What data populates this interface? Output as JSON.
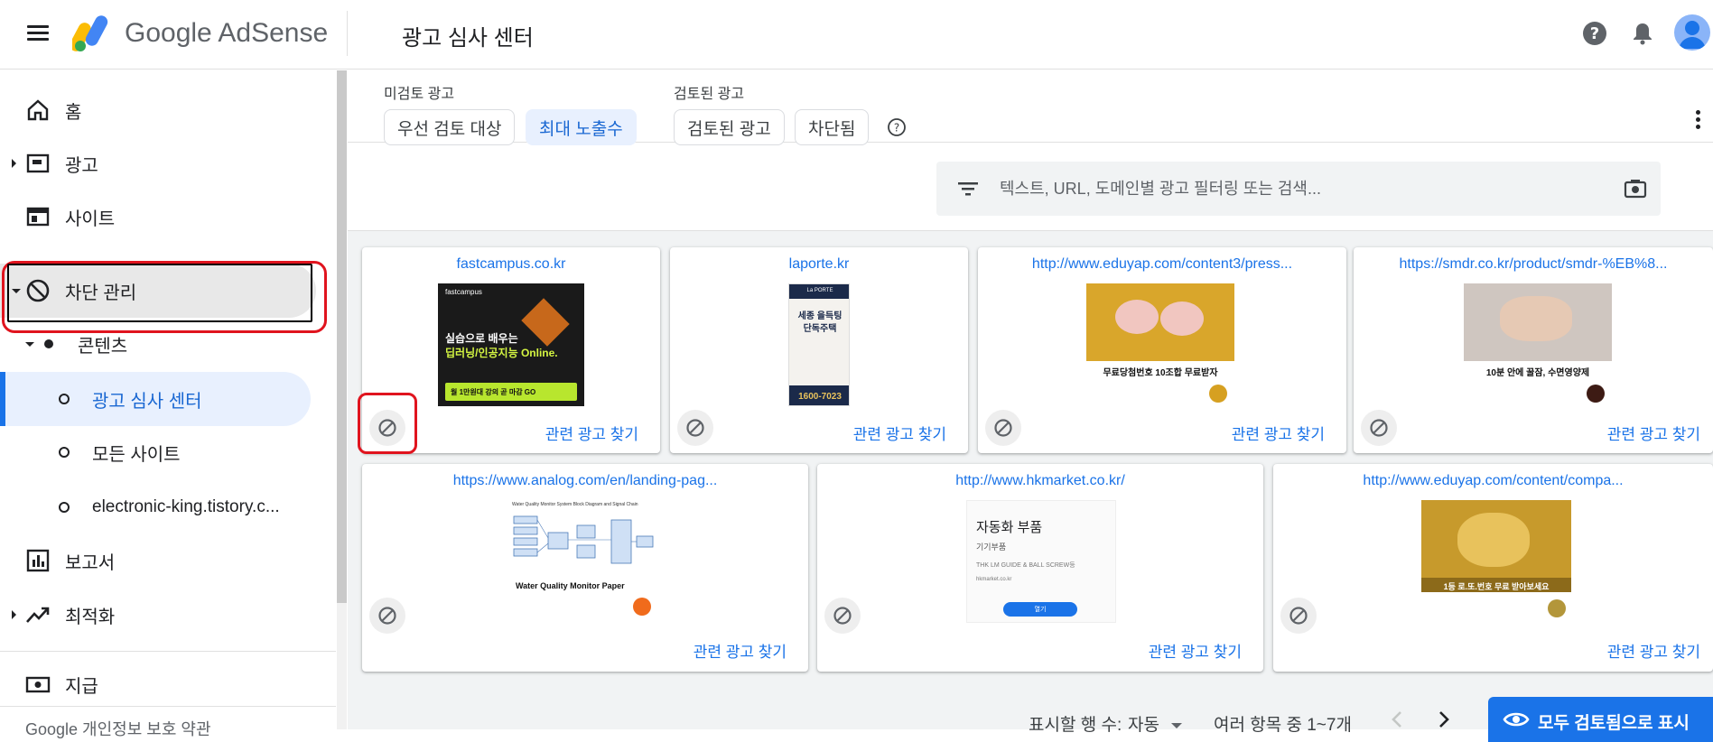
{
  "header": {
    "brand": "Google AdSense",
    "title": "광고 심사 센터"
  },
  "sidebar": {
    "items": [
      {
        "label": "홈"
      },
      {
        "label": "광고"
      },
      {
        "label": "사이트"
      },
      {
        "label": "차단 관리"
      },
      {
        "label": "콘텐츠"
      },
      {
        "label": "광고 심사 센터"
      },
      {
        "label": "모든 사이트"
      },
      {
        "label": "electronic-king.tistory.c..."
      },
      {
        "label": "보고서"
      },
      {
        "label": "최적화"
      },
      {
        "label": "지급"
      }
    ],
    "footer": "Google  개인정보 보호  약관"
  },
  "filters": {
    "unreviewed_title": "미검토 광고",
    "reviewed_title": "검토된 광고",
    "chips": [
      "우선 검토 대상",
      "최대 노출수",
      "검토된 광고",
      "차단됨"
    ],
    "search_placeholder": "텍스트, URL, 도메인별 광고 필터링 또는 검색..."
  },
  "cards": [
    {
      "url": "fastcampus.co.kr",
      "related": "관련 광고 찾기",
      "creative": {
        "brand": "fastcampus",
        "line1": "실습으로 배우는",
        "line2": "딥러닝/인공지능 Online.",
        "cta": "월 1만원대 강의 곧 마감 GO"
      }
    },
    {
      "url": "laporte.kr",
      "related": "관련 광고 찾기",
      "creative": {
        "brand": "La PORTE",
        "line1": "세종 을득팅",
        "line2": "단독주택",
        "phone": "1600-7023"
      }
    },
    {
      "url": "http://www.eduyap.com/content3/press...",
      "related": "관련 광고 찾기",
      "creative": {
        "caption": "무료당첨번호 10조합 무료받자"
      }
    },
    {
      "url": "https://smdr.co.kr/product/smdr-%EB%8...",
      "related": "관련 광고 찾기",
      "creative": {
        "caption": "10분 안에 꿀잠, 수면영양제"
      }
    },
    {
      "url": "https://www.analog.com/en/landing-pag...",
      "related": "관련 광고 찾기",
      "creative": {
        "header": "Water Quality Monitor System Block Diagram and Signal Chain",
        "caption": "Water Quality Monitor Paper"
      }
    },
    {
      "url": "http://www.hkmarket.co.kr/",
      "related": "관련 광고 찾기",
      "creative": {
        "title": "자동화 부품",
        "sub": "기기부품",
        "body": "THK LM GUIDE & BALL SCREW등",
        "domain": "hkmarket.co.kr",
        "cta": "열기"
      }
    },
    {
      "url": "http://www.eduyap.com/content/compa...",
      "related": "관련 광고 찾기",
      "creative": {
        "caption": "1등 로.또.번호 무료 받아보세요"
      }
    }
  ],
  "pager": {
    "rows_label": "표시할 행 수:",
    "rows_value": "자동",
    "range": "여러 항목 중 1~7개"
  },
  "review_all": "모두 검토됨으로 표시",
  "colors": {
    "accent": "#1a73e8",
    "highlight": "#e0141e"
  }
}
